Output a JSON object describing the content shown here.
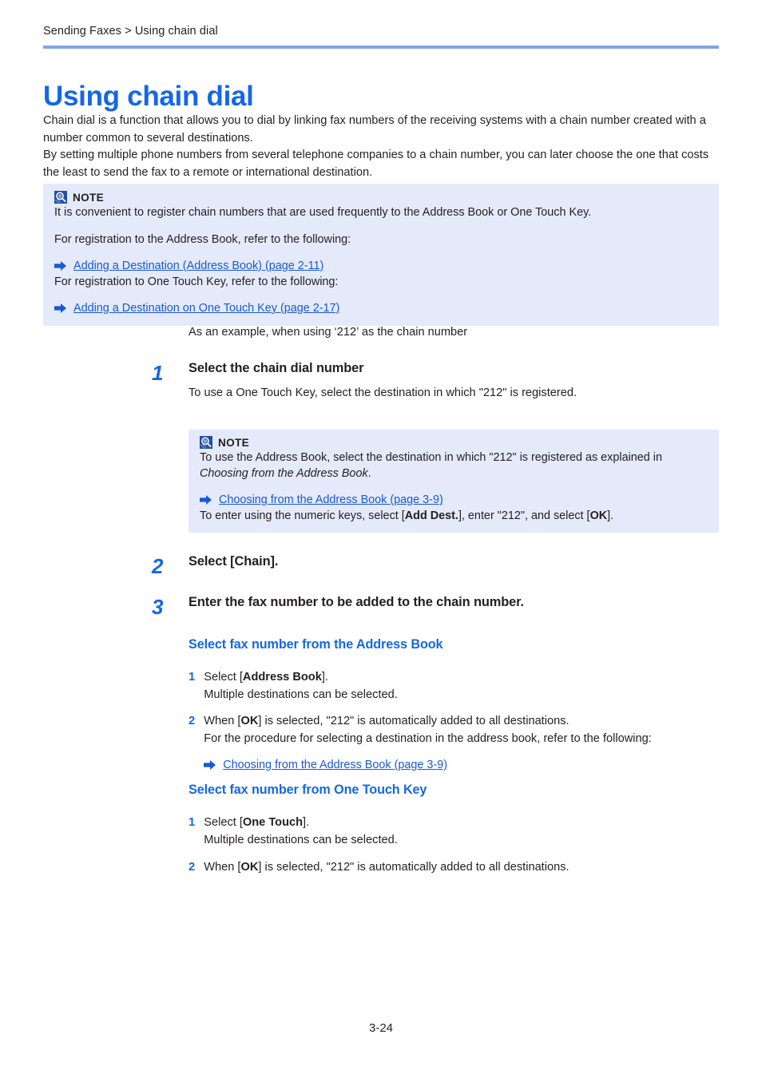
{
  "header": {
    "breadcrumb": "Sending Faxes > Using chain dial",
    "rule_color": "#7FA6E3"
  },
  "title": "Using chain dial",
  "accent_color": "#1467E8",
  "link_color": "#1A58D4",
  "note_bg_color": "#E4EAFA",
  "intro": {
    "line1": "Chain dial is a function that allows you to dial by linking fax numbers of the receiving systems with a chain number created with a number common to several destinations.",
    "line2": "By setting multiple phone numbers from several telephone companies to a chain number, you can later choose the one that costs the least to send the fax to a remote or international destination."
  },
  "note1": {
    "label": "NOTE",
    "icon": "note-magnifier-icon",
    "text1": "It is convenient to register chain numbers that are used frequently to the Address Book or One Touch Key.",
    "text2": "For registration to the Address Book, refer to the following:",
    "link1": "Adding a Destination (Address Book) (page 2-11)",
    "text3": "For registration to One Touch Key, refer to the following:",
    "link2": "Adding a Destination on One Touch Key (page 2-17)"
  },
  "example_line": "As an example, when using ‘212’ as the chain number",
  "steps": [
    {
      "num": "1",
      "title": "Select the chain dial number",
      "desc": "To use a One Touch Key, select the destination in which \"212\" is registered."
    },
    {
      "num": "2",
      "title": "Select [Chain]."
    },
    {
      "num": "3",
      "title": "Enter the fax number to be added to the chain number."
    }
  ],
  "note2": {
    "label": "NOTE",
    "icon": "note-magnifier-icon",
    "text1_a": "To use the Address Book, select the destination in which \"212\" is registered as explained in ",
    "text1_italic": "Choosing from the Address Book",
    "text1_b": ".",
    "link1": "Choosing from the Address Book (page 3-9)",
    "text2_a": "To enter using the numeric keys, select [",
    "text2_bold1": "Add Dest.",
    "text2_b": "], enter \"212\", and select [",
    "text2_bold2": "OK",
    "text2_c": "]."
  },
  "section_address_book": {
    "heading": "Select fax number from the Address Book",
    "substep1": {
      "num": "1",
      "line1_a": "Select [",
      "line1_bold": "Address Book",
      "line1_b": "].",
      "line2": "Multiple destinations can be selected."
    },
    "substep2": {
      "num": "2",
      "line1_a": "When [",
      "line1_bold": "OK",
      "line1_b": "] is selected, \"212\" is automatically added to all destinations.",
      "line2": "For the procedure for selecting a destination in the address book, refer to the following:",
      "link": "Choosing from the Address Book (page 3-9)"
    }
  },
  "section_one_touch": {
    "heading": "Select fax number from One Touch Key",
    "substep1": {
      "num": "1",
      "line1_a": "Select [",
      "line1_bold": "One Touch",
      "line1_b": "].",
      "line2": "Multiple destinations can be selected."
    },
    "substep2": {
      "num": "2",
      "line1_a": "When [",
      "line1_bold": "OK",
      "line1_b": "] is selected, \"212\" is automatically added to all destinations."
    }
  },
  "footer": {
    "page_number": "3-24"
  }
}
